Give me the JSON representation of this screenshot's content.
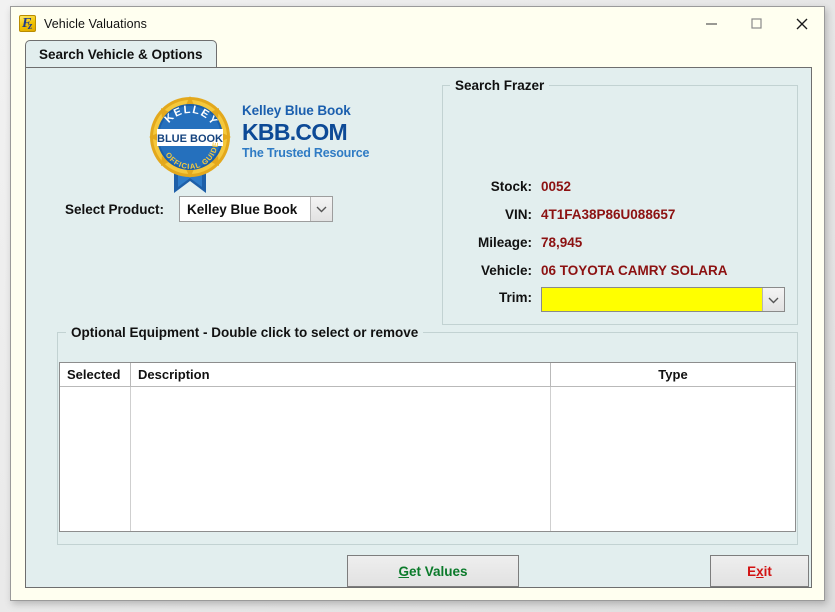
{
  "window": {
    "title": "Vehicle Valuations",
    "app_icon": "frazer-app-icon",
    "minimize_label": "–",
    "maximize_label": "□",
    "close_label": "✕"
  },
  "tabs": [
    {
      "label": "Search Vehicle & Options",
      "active": true
    }
  ],
  "branding": {
    "seal": {
      "arc_top": "KELLEY",
      "band": "BLUE BOOK",
      "arc_bottom": "OFFICIAL GUIDE"
    },
    "wordmark_line1": "Kelley Blue Book",
    "wordmark_line2": "KBB.COM",
    "wordmark_line3": "The Trusted Resource"
  },
  "product": {
    "label": "Select Product:",
    "value": "Kelley Blue Book",
    "options": [
      "Kelley Blue Book"
    ]
  },
  "search_frazer": {
    "title": "Search Frazer",
    "fields": [
      {
        "label": "Stock:",
        "value": "0052"
      },
      {
        "label": "VIN:",
        "value": "4T1FA38P86U088657"
      },
      {
        "label": "Mileage:",
        "value": "78,945"
      },
      {
        "label": "Vehicle:",
        "value": "06 TOYOTA CAMRY SOLARA"
      }
    ],
    "trim": {
      "label": "Trim:",
      "value": "",
      "highlight_color": "#ffff00"
    }
  },
  "optional_equipment": {
    "title": "Optional Equipment - Double click to select or remove",
    "columns": [
      "Selected",
      "Description",
      "Type"
    ],
    "rows": []
  },
  "buttons": {
    "get_values": {
      "prefix": "",
      "accel": "G",
      "suffix": "et Values",
      "color": "#0a7a2a"
    },
    "exit": {
      "prefix": "E",
      "accel": "x",
      "suffix": "it",
      "color": "#d21212"
    }
  },
  "colors": {
    "window_frame": "#fffff0",
    "tab_page": "#e2eeee",
    "value_text": "#8c1111",
    "kbb_blue": "#0d4a96",
    "trim_highlight": "#ffff00"
  }
}
